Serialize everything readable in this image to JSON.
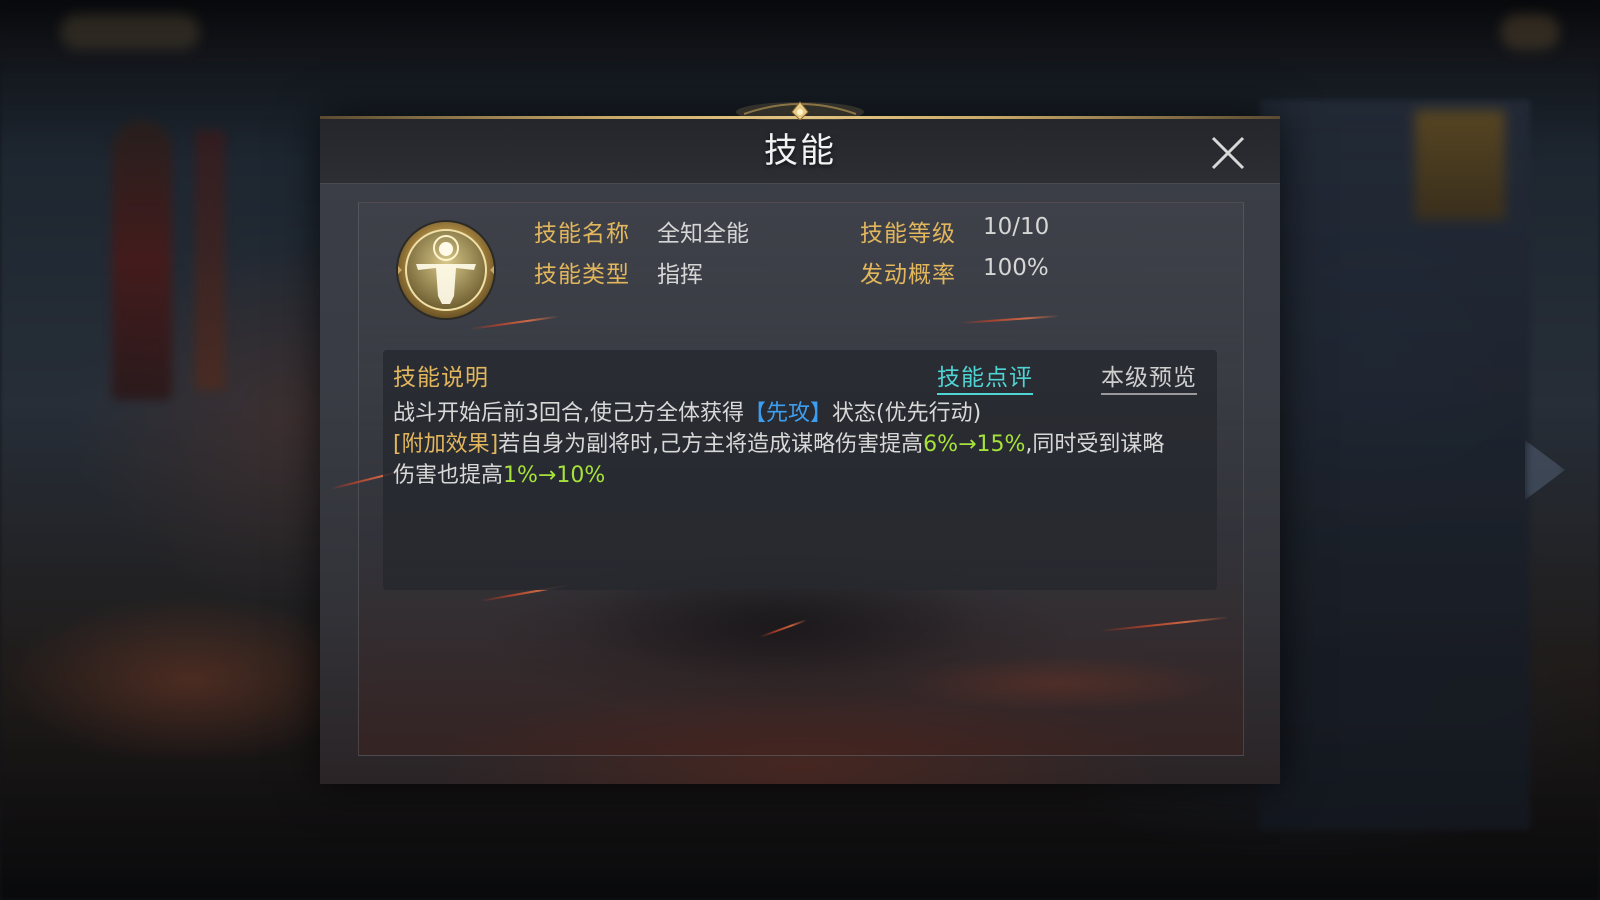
{
  "dialog": {
    "title": "技能",
    "close_icon": "close-icon"
  },
  "skill": {
    "icon": "skill-portrait-icon",
    "name_label": "技能名称",
    "name_value": "全知全能",
    "level_label": "技能等级",
    "level_value": "10/10",
    "type_label": "技能类型",
    "type_value": "指挥",
    "chance_label": "发动概率",
    "chance_value": "100%"
  },
  "description": {
    "title": "技能说明",
    "tabs": [
      {
        "label": "技能点评",
        "active": true
      },
      {
        "label": "本级预览",
        "active": false
      }
    ],
    "line1_prefix": "战斗开始后前3回合,使己方全体获得",
    "line1_keyword": "【先攻】",
    "line1_suffix": "状态(优先行动)",
    "extra_tag": "[附加效果]",
    "extra_text_1": "若自身为副将时,己方主将造成谋略伤害提高",
    "extra_value_1": "6%→15%",
    "extra_text_2": ",同时受到谋略伤害也提高",
    "extra_value_2": "1%→10%"
  },
  "colors": {
    "label_gold": "#e2b65c",
    "keyword_blue": "#3c9ef0",
    "value_green": "#a6e23a",
    "active_tab_cyan": "#4fd4d4"
  }
}
